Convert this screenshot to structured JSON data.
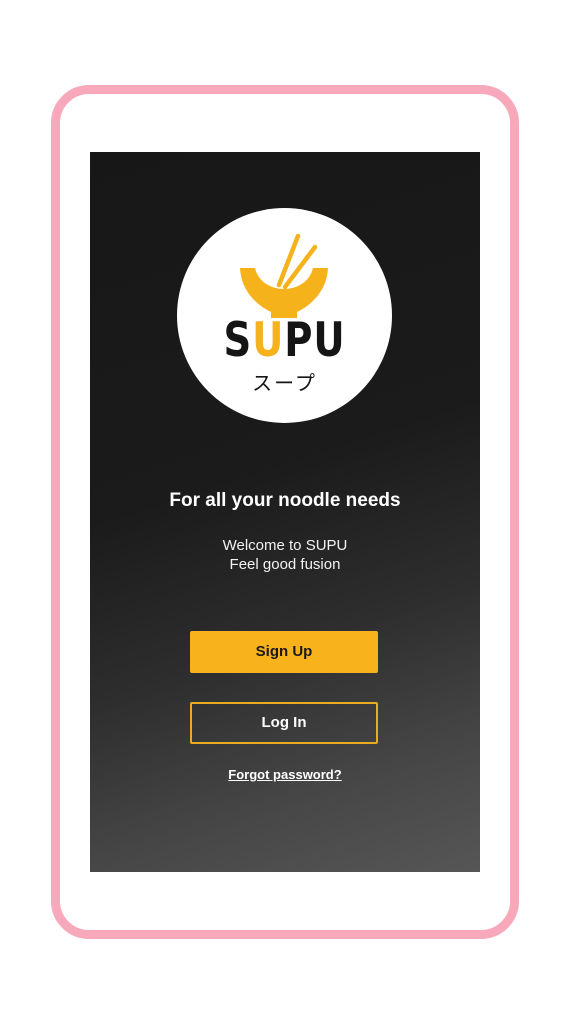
{
  "colors": {
    "frame_border": "#f7a9bb",
    "screen_background_top": "#171717",
    "screen_background_bottom": "#565656",
    "accent": "#f7b21c",
    "text_primary": "#ffffff",
    "logo_text": "#151515"
  },
  "logo": {
    "wordmark_s": "S",
    "wordmark_u": "U",
    "wordmark_rest": "PU",
    "katakana": "スープ",
    "icon": "noodle-bowl-chopsticks-icon"
  },
  "welcome": {
    "tagline": "For all your noodle needs",
    "line1": "Welcome to SUPU",
    "line2": "Feel good fusion"
  },
  "actions": {
    "signup_label": "Sign Up",
    "login_label": "Log In",
    "forgot_label": "Forgot password?"
  }
}
